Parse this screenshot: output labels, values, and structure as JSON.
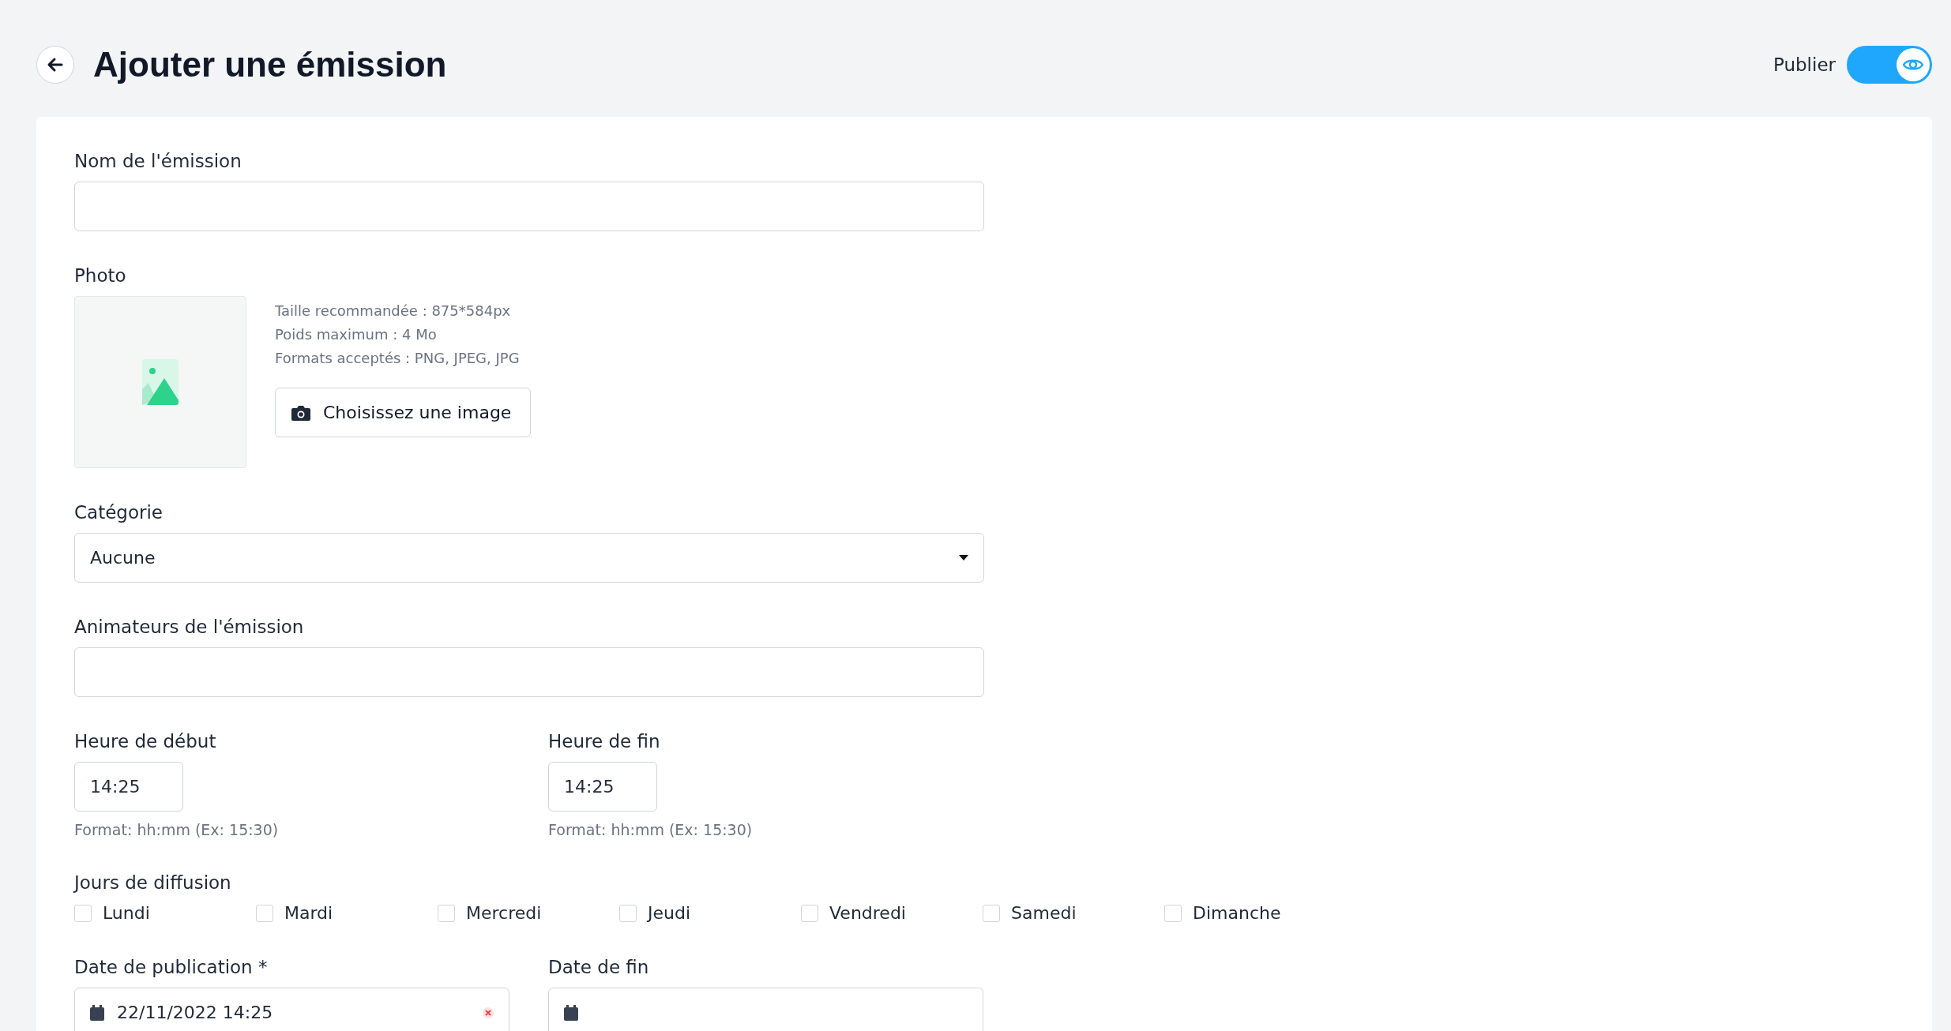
{
  "header": {
    "title": "Ajouter une émission",
    "publish": {
      "label": "Publier",
      "on": true
    }
  },
  "form": {
    "name": {
      "label": "Nom de l'émission"
    },
    "photo": {
      "label": "Photo",
      "hints": [
        "Taille recommandée : 875*584px",
        "Poids maximum : 4 Mo",
        "Formats acceptés : PNG, JPEG, JPG"
      ],
      "button": "Choisissez une image"
    },
    "category": {
      "label": "Catégorie",
      "value": "Aucune"
    },
    "hosts": {
      "label": "Animateurs de l'émission"
    },
    "times": [
      {
        "label": "Heure de début",
        "value": "14:25",
        "hint": "Format: hh:mm (Ex: 15:30)"
      },
      {
        "label": "Heure de fin",
        "value": "14:25",
        "hint": "Format: hh:mm (Ex: 15:30)"
      }
    ],
    "days": {
      "label": "Jours de diffusion",
      "items": [
        {
          "label": "Lundi",
          "checked": false
        },
        {
          "label": "Mardi",
          "checked": false
        },
        {
          "label": "Mercredi",
          "checked": false
        },
        {
          "label": "Jeudi",
          "checked": false
        },
        {
          "label": "Vendredi",
          "checked": false
        },
        {
          "label": "Samedi",
          "checked": false
        },
        {
          "label": "Dimanche",
          "checked": false
        }
      ]
    },
    "dates": [
      {
        "label": "Date de publication *",
        "value": "22/11/2022 14:25",
        "clearable": true
      },
      {
        "label": "Date de fin",
        "clearable": false
      }
    ]
  }
}
